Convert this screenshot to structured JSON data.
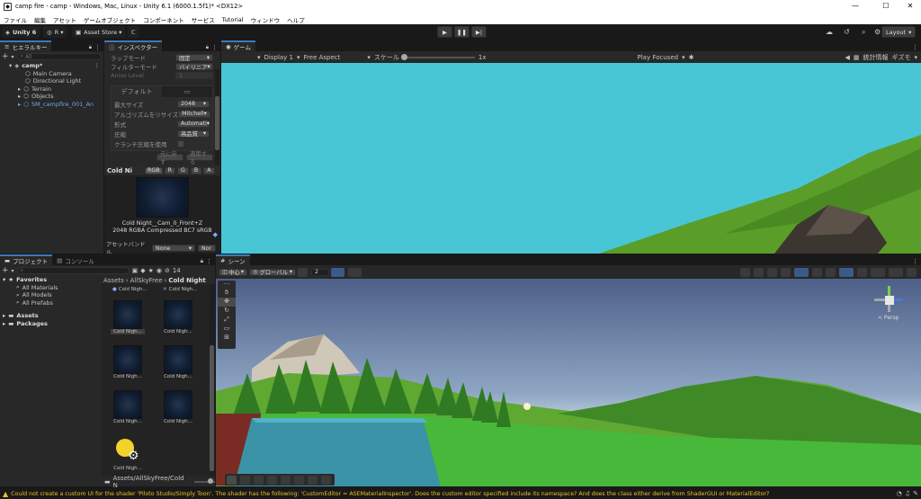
{
  "window": {
    "title": "camp fire - camp - Windows, Mac, Linux - Unity 6.1 (6000.1.5f1)* <DX12>",
    "controls": [
      "—",
      "☐",
      "✕"
    ]
  },
  "menu": [
    "ファイル",
    "編集",
    "アセット",
    "ゲームオブジェクト",
    "コンポーネント",
    "サービス",
    "Tutorial",
    "ウィンドウ",
    "ヘルプ"
  ],
  "toolbar": {
    "unity_label": "Unity 6",
    "account_label": "R",
    "asset_store_label": "Asset Store",
    "layout_label": "Layout"
  },
  "hierarchy": {
    "tab_label": "ヒエラルキー",
    "search_placeholder": "All",
    "scene_name": "camp*",
    "items": [
      "Main Camera",
      "Directional Light",
      "Terrain",
      "Objects",
      "SM_campfire_001_An"
    ]
  },
  "inspector": {
    "tab_label": "インスペクター",
    "wrap_mode_label": "ラップモード",
    "wrap_mode_value": "固定",
    "filter_mode_label": "フィルターモード",
    "filter_mode_value": "バイリニア",
    "aniso_label": "Aniso Level",
    "aniso_value": "1",
    "platform_tab": "デフォルト",
    "max_size_label": "最大サイズ",
    "max_size_value": "2048",
    "resize_algo_label": "アルゴリズムをリサイズ",
    "resize_algo_value": "Mitchell",
    "format_label": "形式",
    "format_value": "Automati",
    "compression_label": "圧縮",
    "compression_value": "高品質",
    "crunch_label": "クランチ圧縮を使用",
    "revert_label": "元に戻す",
    "apply_label": "適用する",
    "preview_title": "Cold Ni",
    "channels": [
      "RGB",
      "R",
      "G",
      "B",
      "A"
    ],
    "preview_name": "Cold Night__Cam_0_Front+Z",
    "preview_info": "2048  RGBA Compressed BC7 sRGB",
    "asset_bundle_label": "アセットバンドル",
    "asset_bundle_value": "None",
    "asset_bundle_variant": "Nor"
  },
  "game": {
    "tab_label": "ゲーム",
    "display_label": "Display 1",
    "aspect_label": "Free Aspect",
    "scale_label": "スケール",
    "scale_value": "1x",
    "play_focused_label": "Play Focused",
    "stats_label": "統計情報",
    "gizmos_label": "ギズモ"
  },
  "project": {
    "tab_label": "プロジェクト",
    "console_tab_label": "コンソール",
    "favorites_label": "Favorites",
    "favorites_items": [
      "All Materials",
      "All Models",
      "All Prefabs"
    ],
    "assets_label": "Assets",
    "packages_label": "Packages",
    "count_label": "14",
    "breadcrumb": [
      "Assets",
      "AllSkyFree",
      "Cold Night"
    ],
    "item_label": "Cold Nigh...",
    "footer_path": "Assets/AllSkyFree/Cold N"
  },
  "scene": {
    "tab_label": "シーン",
    "center_label": "中心",
    "global_label": "グローバル",
    "snap_value": "2",
    "persp_label": "< Persp"
  },
  "status": {
    "message": "Could not create a custom UI for the shader 'Piloto Studio/Simply Toon'. The shader has the following: 'CustomEditor = ASEMaterialInspector'. Does the custom editor specified include its namespace? And does the class either derive from ShaderGUI or MaterialEditor?"
  },
  "colors": {
    "sky_game": "#49c6d6",
    "grass": "#5aa02a",
    "selection_blue": "#3a79bb",
    "warning_yellow": "#f0c020"
  }
}
